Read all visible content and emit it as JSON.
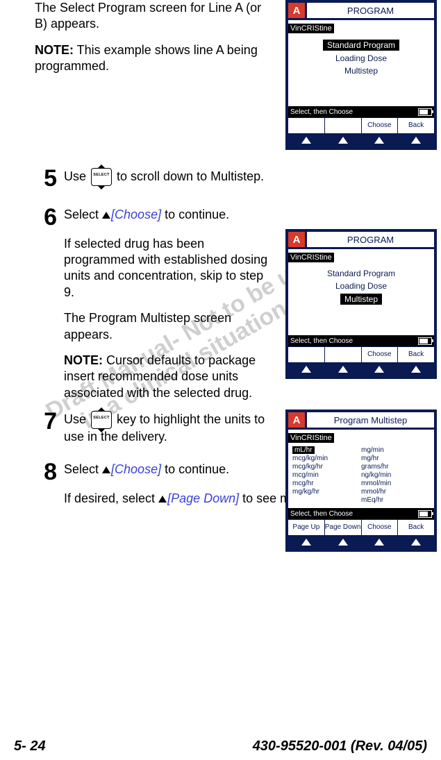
{
  "watermark": {
    "line1": "Draft Manual- Not to be used",
    "line2": "in a clinical situation."
  },
  "text": {
    "intro1": "The Select Program screen for Line A (or B) appears.",
    "note1_label": "NOTE:",
    "note1": " This example shows line A being programmed.",
    "step5": "Use ",
    "step5b": " to scroll down to Multistep.",
    "step6a": "Select ",
    "step6b_label": "[Choose]",
    "step6c": " to continue.",
    "step6_para1": "If selected drug has been programmed with established dosing units and concentration, skip to step 9.",
    "step6_para2": "The Program Multistep screen appears.",
    "note2_label": "NOTE:",
    "note2": " Cursor defaults to package insert recommended dose units associated with the selected drug.",
    "step7a": "Use ",
    "step7b": " key to highlight the units to use in the delivery.",
    "step8a": "Select ",
    "step8b_label": "[Choose]",
    "step8c": " to continue.",
    "step8_para_a": "If desired, select ",
    "step8_para_b": "[Page Down]",
    "step8_para_c": " to see more units of"
  },
  "step_numbers": {
    "s5": "5",
    "s6": "6",
    "s7": "7",
    "s8": "8"
  },
  "footer": {
    "page": "5- 24",
    "doc": "430-95520-001 (Rev. 04/05)"
  },
  "device1": {
    "line": "A",
    "title": "PROGRAM",
    "drug": "VinCRIStine",
    "opts": [
      "Standard Program",
      "Loading Dose",
      "Multistep"
    ],
    "selected": 0,
    "bar": "Select, then Choose",
    "soft": [
      "",
      "",
      "Choose",
      "Back"
    ]
  },
  "device2": {
    "line": "A",
    "title": "PROGRAM",
    "drug": "VinCRIStine",
    "opts": [
      "Standard Program",
      "Loading Dose",
      "Multistep"
    ],
    "selected": 2,
    "bar": "Select, then Choose",
    "soft": [
      "",
      "",
      "Choose",
      "Back"
    ]
  },
  "device3": {
    "line": "A",
    "title": "Program Multistep",
    "drug": "VinCRIStine",
    "units_col1": [
      "mL/hr",
      "mcg/kg/min",
      "mcg/kg/hr",
      "mcg/min",
      "mcg/hr",
      "mg/kg/hr"
    ],
    "units_col2": [
      "mg/min",
      "mg/hr",
      "grams/hr",
      "ng/kg/min",
      "mmol/min",
      "mmol/hr",
      "mEq/hr"
    ],
    "selected_unit": "mL/hr",
    "bar": "Select, then Choose",
    "soft": [
      "Page Up",
      "Page Down",
      "Choose",
      "Back"
    ]
  }
}
